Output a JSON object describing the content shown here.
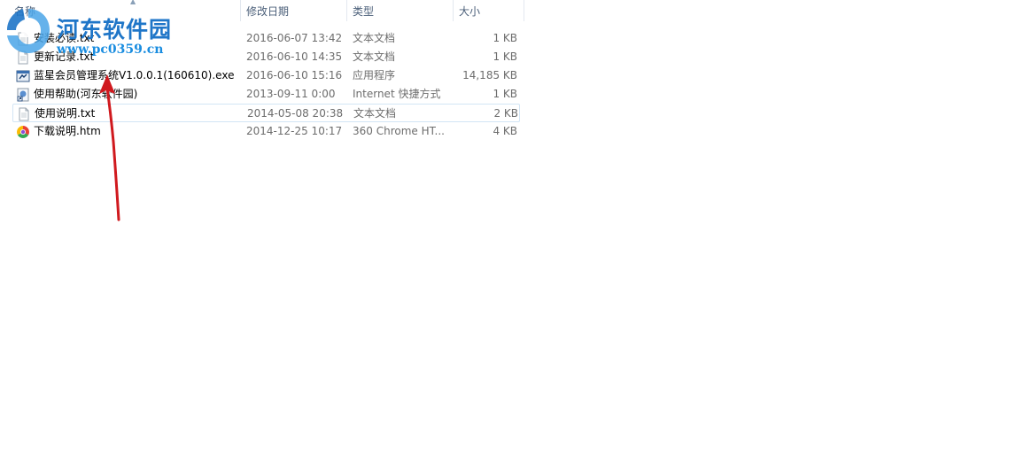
{
  "columns": {
    "name": "名称",
    "date": "修改日期",
    "type": "类型",
    "size": "大小"
  },
  "files": [
    {
      "name": "安装必读.txt",
      "date": "2016-06-07 13:42",
      "type": "文本文档",
      "size": "1 KB",
      "icon": "text-file-icon"
    },
    {
      "name": "更新记录.txt",
      "date": "2016-06-10 14:35",
      "type": "文本文档",
      "size": "1 KB",
      "icon": "text-file-icon"
    },
    {
      "name": "蓝星会员管理系统V1.0.0.1(160610).exe",
      "date": "2016-06-10 15:16",
      "type": "应用程序",
      "size": "14,185 KB",
      "icon": "application-icon"
    },
    {
      "name": "使用帮助(河东软件园)",
      "date": "2013-09-11 0:00",
      "type": "Internet 快捷方式",
      "size": "1 KB",
      "icon": "internet-shortcut-icon"
    },
    {
      "name": "使用说明.txt",
      "date": "2014-05-08 20:38",
      "type": "文本文档",
      "size": "2 KB",
      "icon": "text-file-icon"
    },
    {
      "name": "下载说明.htm",
      "date": "2014-12-25 10:17",
      "type": "360 Chrome HT...",
      "size": "4 KB",
      "icon": "chrome-html-icon"
    }
  ],
  "watermark": {
    "title": "河东软件园",
    "url": "www.pc0359.cn"
  },
  "colors": {
    "header_text": "#4c607a",
    "selection_border": "#d2e5f5",
    "watermark_blue": "#1f76c8",
    "arrow_red": "#d0191e"
  }
}
